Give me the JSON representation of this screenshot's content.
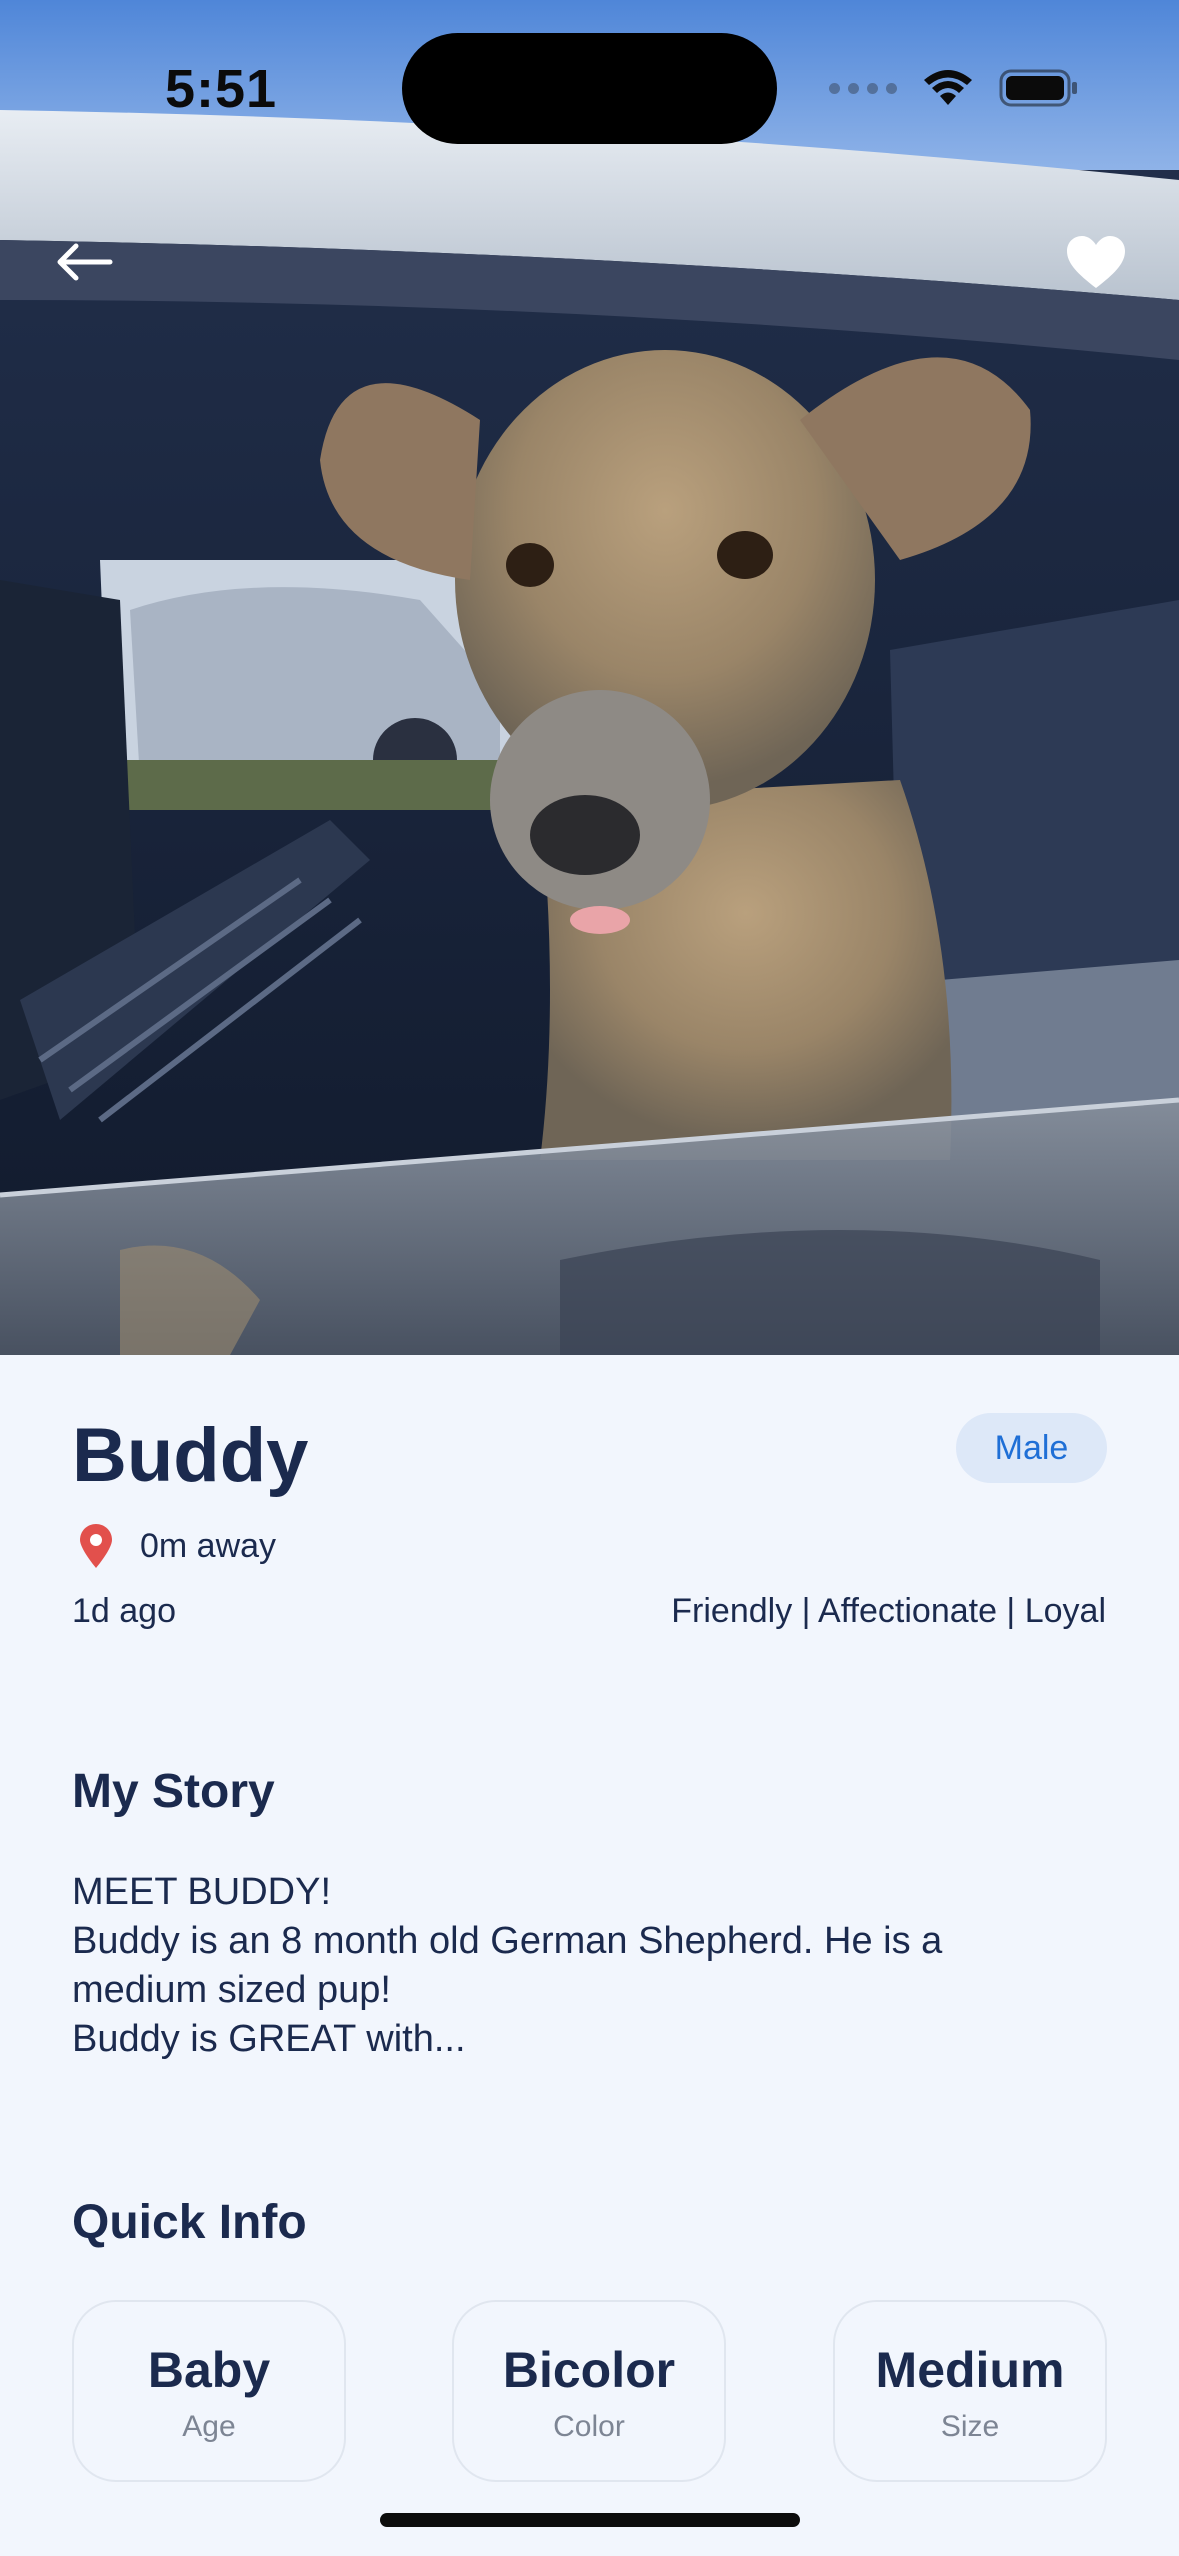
{
  "status_bar": {
    "time": "5:51"
  },
  "hero": {
    "back_icon": "arrow-left-icon",
    "favorite_icon": "heart-icon"
  },
  "pet": {
    "name": "Buddy",
    "sex": "Male",
    "distance": "0m away",
    "posted": "1d ago",
    "traits": "Friendly | Affectionate | Loyal"
  },
  "story": {
    "title": "My Story",
    "lines": [
      "MEET BUDDY!",
      "Buddy is an 8 month old German Shepherd. He is a",
      "medium sized pup!",
      "Buddy is GREAT with..."
    ]
  },
  "quick_info": {
    "title": "Quick Info",
    "cards": [
      {
        "value": "Baby",
        "label": "Age"
      },
      {
        "value": "Bicolor",
        "label": "Color"
      },
      {
        "value": "Medium",
        "label": "Size"
      }
    ]
  },
  "colors": {
    "accent": "#1f6fd6",
    "badge_bg": "#dde8f8",
    "text": "#1b2a4e",
    "pin": "#e2504c",
    "page_bg": "#f2f6fd"
  }
}
